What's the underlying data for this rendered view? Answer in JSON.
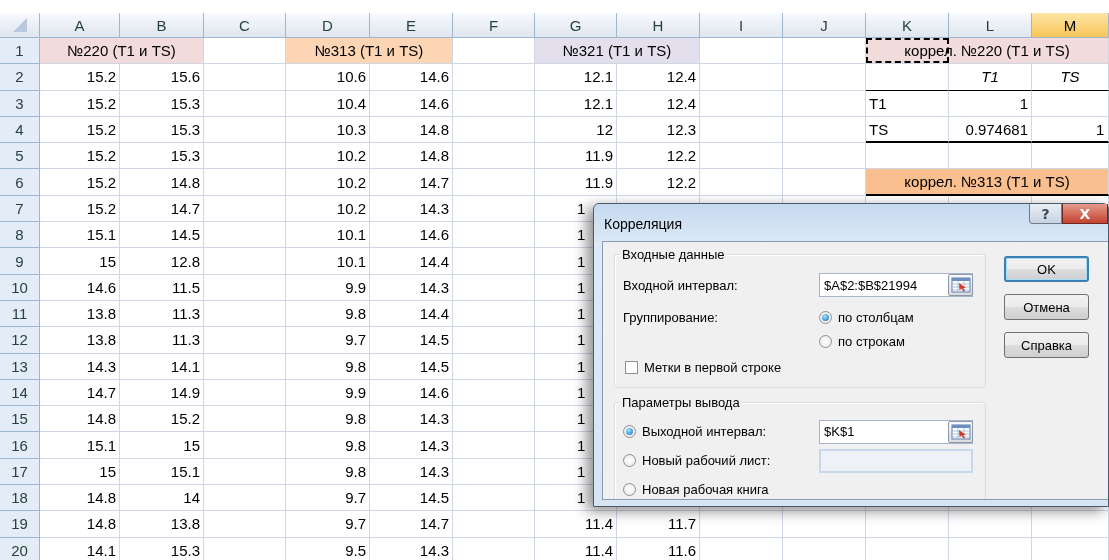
{
  "sheet": {
    "columns": [
      {
        "label": "A",
        "selected": false
      },
      {
        "label": "B",
        "selected": false
      },
      {
        "label": "C",
        "selected": false
      },
      {
        "label": "D",
        "selected": false
      },
      {
        "label": "E",
        "selected": false
      },
      {
        "label": "F",
        "selected": false
      },
      {
        "label": "G",
        "selected": false
      },
      {
        "label": "H",
        "selected": false
      },
      {
        "label": "I",
        "selected": false
      },
      {
        "label": "J",
        "selected": false
      },
      {
        "label": "K",
        "selected": false
      },
      {
        "label": "L",
        "selected": false
      },
      {
        "label": "M",
        "selected": true
      }
    ],
    "rows": [
      {
        "number": "1",
        "cells": {
          "a_b": {
            "text": "№220 (T1 и TS)",
            "color": "#f2dcdb"
          },
          "d_e": {
            "text": "№313 (T1 и TS)",
            "color": "#fcd5b4"
          },
          "g_h": {
            "text": "№321 (T1 и TS)",
            "color": "#e4dfec"
          },
          "k_m": {
            "text": "коррел. №220 (T1 и TS)",
            "color": "#f2dcdb",
            "marquee": true
          }
        }
      },
      {
        "number": "2",
        "cells": {
          "a": "15.2",
          "b": "15.6",
          "d": "10.6",
          "e": "14.6",
          "g": "12.1",
          "h": "12.4",
          "k": {
            "thin_rule": true
          },
          "l": {
            "text": "T1",
            "kind": "heading",
            "thin_rule": true
          },
          "m": {
            "text": "TS",
            "kind": "heading",
            "thin_rule": true
          }
        }
      },
      {
        "number": "3",
        "cells": {
          "a": "15.2",
          "b": "15.3",
          "d": "10.4",
          "e": "14.6",
          "g": "12.1",
          "h": "12.4",
          "k": {
            "text": "T1",
            "kind": "label"
          },
          "l": "1"
        }
      },
      {
        "number": "4",
        "cells": {
          "a": "15.2",
          "b": "15.3",
          "d": "10.3",
          "e": "14.8",
          "g": "12",
          "h": "12.3",
          "k": {
            "text": "TS",
            "kind": "label",
            "thick_rule": true
          },
          "l": {
            "text": "0.974681",
            "thick_rule": true
          },
          "m": {
            "text": "1",
            "kind": "cut",
            "thick_rule": true
          }
        }
      },
      {
        "number": "5",
        "cells": {
          "a": "15.2",
          "b": "15.3",
          "d": "10.2",
          "e": "14.8",
          "g": "11.9",
          "h": "12.2"
        }
      },
      {
        "number": "6",
        "cells": {
          "a": "15.2",
          "b": "14.8",
          "d": "10.2",
          "e": "14.7",
          "g": "11.9",
          "h": "12.2",
          "k_m": {
            "text": "коррел. №313 (T1 и TS)",
            "color": "#fabf8f",
            "thick_rule": true
          }
        }
      },
      {
        "number": "7",
        "cells": {
          "a": "15.2",
          "b": "14.7",
          "d": "10.2",
          "e": "14.3",
          "g": {
            "text": "1",
            "kind": "covered"
          }
        }
      },
      {
        "number": "8",
        "cells": {
          "a": "15.1",
          "b": "14.5",
          "d": "10.1",
          "e": "14.6",
          "g": {
            "text": "1",
            "kind": "covered"
          }
        }
      },
      {
        "number": "9",
        "cells": {
          "a": "15",
          "b": "12.8",
          "d": "10.1",
          "e": "14.4",
          "g": {
            "text": "1",
            "kind": "covered"
          }
        }
      },
      {
        "number": "10",
        "cells": {
          "a": "14.6",
          "b": "11.5",
          "d": "9.9",
          "e": "14.3",
          "g": {
            "text": "1",
            "kind": "covered"
          }
        }
      },
      {
        "number": "11",
        "cells": {
          "a": "13.8",
          "b": "11.3",
          "d": "9.8",
          "e": "14.4",
          "g": {
            "text": "1",
            "kind": "covered"
          }
        }
      },
      {
        "number": "12",
        "cells": {
          "a": "13.8",
          "b": "11.3",
          "d": "9.7",
          "e": "14.5",
          "g": {
            "text": "1",
            "kind": "covered"
          }
        }
      },
      {
        "number": "13",
        "cells": {
          "a": "14.3",
          "b": "14.1",
          "d": "9.8",
          "e": "14.5",
          "g": {
            "text": "1",
            "kind": "covered"
          }
        }
      },
      {
        "number": "14",
        "cells": {
          "a": "14.7",
          "b": "14.9",
          "d": "9.9",
          "e": "14.6",
          "g": {
            "text": "1",
            "kind": "covered"
          }
        }
      },
      {
        "number": "15",
        "cells": {
          "a": "14.8",
          "b": "15.2",
          "d": "9.8",
          "e": "14.3",
          "g": {
            "text": "1",
            "kind": "covered"
          }
        }
      },
      {
        "number": "16",
        "cells": {
          "a": "15.1",
          "b": "15",
          "d": "9.8",
          "e": "14.3",
          "g": {
            "text": "1",
            "kind": "covered"
          }
        }
      },
      {
        "number": "17",
        "cells": {
          "a": "15",
          "b": "15.1",
          "d": "9.8",
          "e": "14.3",
          "g": {
            "text": "1",
            "kind": "covered"
          }
        }
      },
      {
        "number": "18",
        "cells": {
          "a": "14.8",
          "b": "14",
          "d": "9.7",
          "e": "14.5",
          "g": {
            "text": "1",
            "kind": "covered"
          }
        }
      },
      {
        "number": "19",
        "cells": {
          "a": "14.8",
          "b": "13.8",
          "d": "9.7",
          "e": "14.7",
          "g": "11.4",
          "h": "11.7"
        }
      },
      {
        "number": "20",
        "cells": {
          "a": "14.1",
          "b": "15.3",
          "d": "9.5",
          "e": "14.3",
          "g": "11.4",
          "h": "11.6"
        }
      }
    ]
  },
  "dialog": {
    "title": "Корреляция",
    "help_button": "?",
    "close_button": "X",
    "input_group": {
      "title": "Входные данные",
      "range_label": "Входной интервал:",
      "range_value": "$A$2:$B$21994",
      "grouping_label": "Группирование:",
      "grouping_options": [
        {
          "label": "по столбцам",
          "selected": true
        },
        {
          "label": "по строкам",
          "selected": false
        }
      ],
      "labels_checkbox": {
        "label": "Метки в первой строке",
        "checked": false
      }
    },
    "output_group": {
      "title": "Параметры вывода",
      "options": [
        {
          "label": "Выходной интервал:",
          "selected": true,
          "kind": "range",
          "value": "$K$1"
        },
        {
          "label": "Новый рабочий лист:",
          "selected": false,
          "kind": "field"
        },
        {
          "label": "Новая рабочая книга",
          "selected": false,
          "kind": "plain"
        }
      ]
    },
    "buttons": [
      {
        "label": "OK",
        "default": true
      },
      {
        "label": "Отмена",
        "default": false
      },
      {
        "label": "Справка",
        "default": false
      }
    ]
  }
}
